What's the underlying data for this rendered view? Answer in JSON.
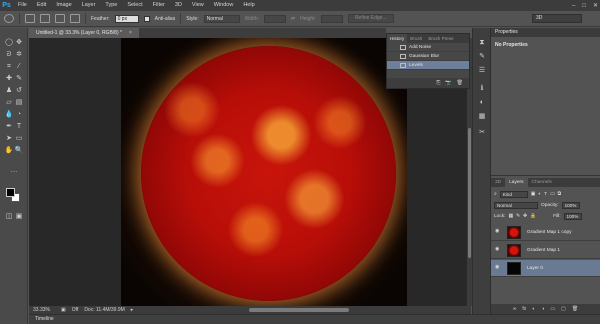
{
  "app": {
    "logo": "Ps",
    "menu": [
      "File",
      "Edit",
      "Image",
      "Layer",
      "Type",
      "Select",
      "Filter",
      "3D",
      "View",
      "Window",
      "Help"
    ],
    "window_controls": [
      "–",
      "□",
      "✕"
    ]
  },
  "options": {
    "feather_label": "Feather:",
    "feather_value": "0 px",
    "antialias_label": "Anti-alias",
    "style_label": "Style:",
    "style_value": "Normal",
    "width_label": "Width:",
    "height_label": "Height:",
    "refine_label": "Refine Edge...",
    "workspace_value": "3D"
  },
  "document": {
    "tab_title": "Untitled-1 @ 33.3% (Layer 0, RGB/8) *",
    "close_glyph": "×"
  },
  "status": {
    "zoom": "33.33%",
    "off_label": "Off",
    "doc_info": "Doc: 11.4M/39.9M",
    "arrow": "▸"
  },
  "timeline": {
    "label": "Timeline"
  },
  "history": {
    "tabs": [
      "History",
      "Brush",
      "Brush Prese"
    ],
    "items": [
      {
        "label": "Add Noise"
      },
      {
        "label": "Gaussian Blur"
      },
      {
        "label": "Levels"
      }
    ],
    "active_index": 2
  },
  "properties": {
    "title": "Properties",
    "body": "No Properties"
  },
  "layers": {
    "tabs": [
      "3D",
      "Layers",
      "Channels"
    ],
    "kind_label": "Kind",
    "blend_mode": "Normal",
    "opacity_label": "Opacity:",
    "opacity_value": "100%",
    "lock_label": "Lock:",
    "fill_label": "Fill:",
    "fill_value": "100%",
    "items": [
      {
        "name": "Gradient Map 1 copy",
        "thumb": "red"
      },
      {
        "name": "Gradient Map 1",
        "thumb": "red"
      },
      {
        "name": "Layer 0",
        "thumb": "black"
      }
    ],
    "active_index": 2,
    "bottom_icons": [
      "∞",
      "fx",
      "◐",
      "◑",
      "▭",
      "▢",
      "🗑"
    ]
  },
  "colors": {
    "accent_selection": "#6d7f9a",
    "sun_core": "#c8150a",
    "ps_blue": "#31a8ff"
  }
}
